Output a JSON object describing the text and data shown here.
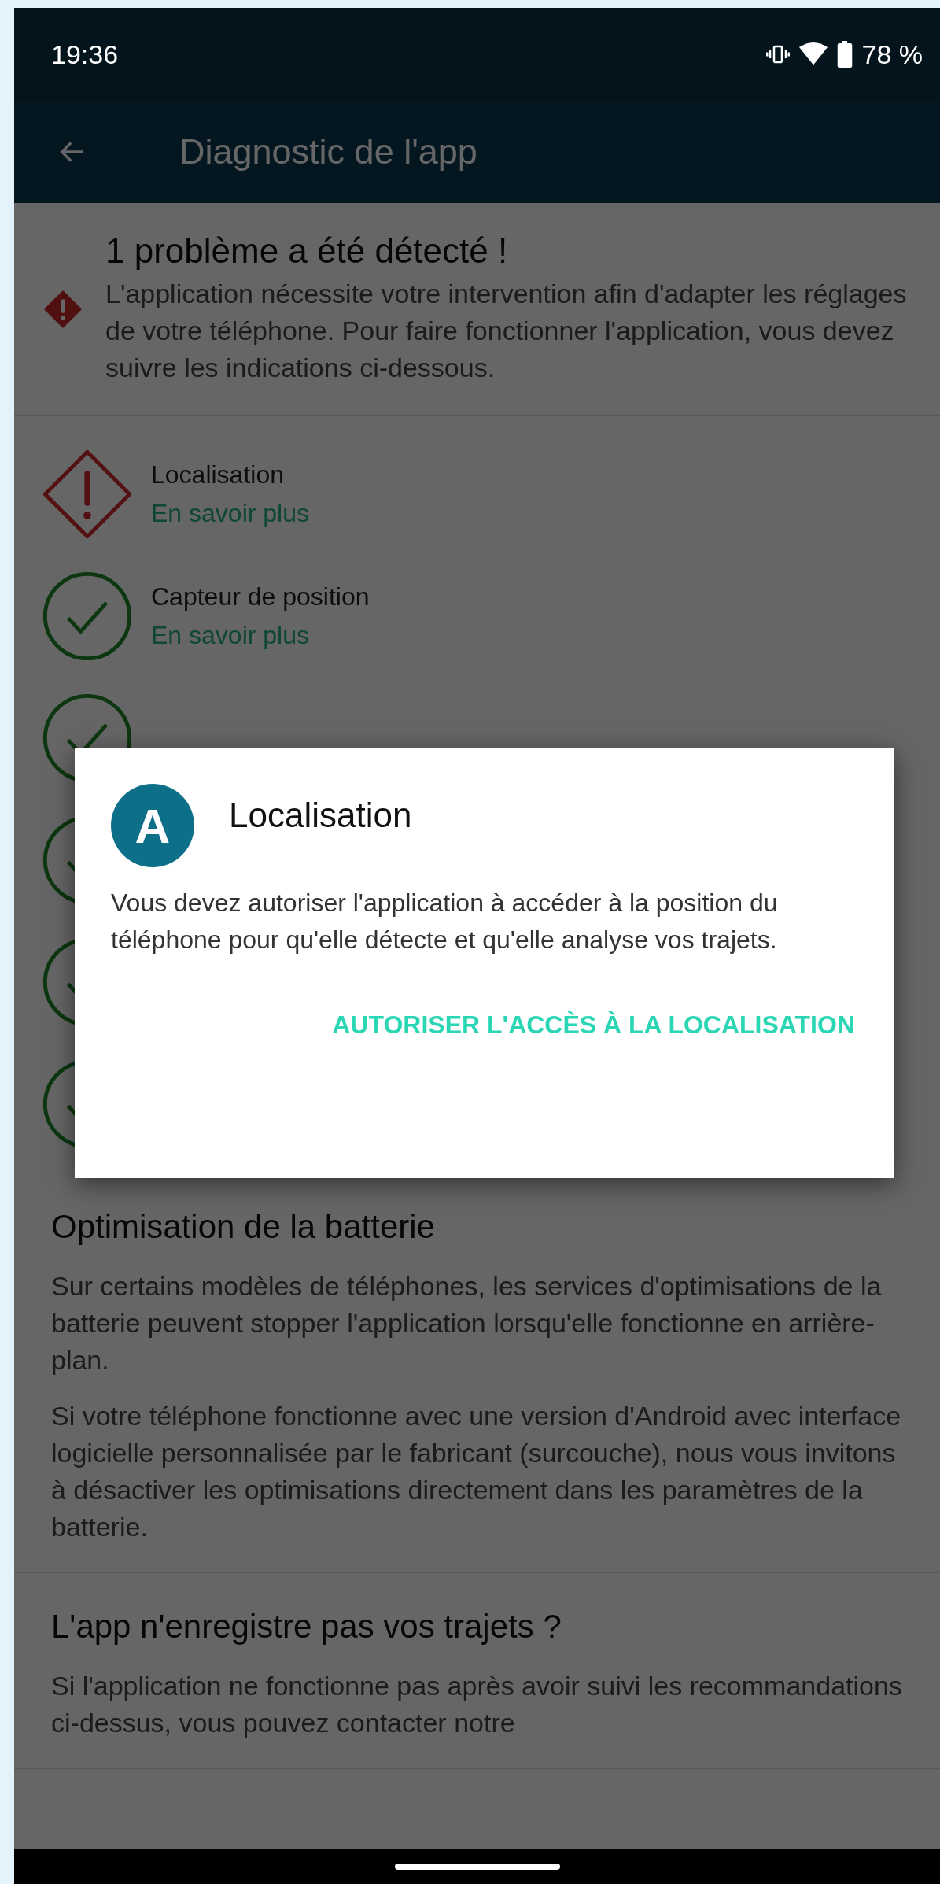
{
  "status_bar": {
    "time": "19:36",
    "battery": "78 %"
  },
  "app_bar": {
    "title": "Diagnostic de l'app"
  },
  "alert": {
    "title": "1 problème a été détecté !",
    "message": "L'application nécessite votre intervention afin d'adapter les réglages de votre téléphone. Pour faire fonctionner l'application, vous devez suivre les indications ci-dessous."
  },
  "checks": [
    {
      "kind": "warning",
      "title": "Localisation",
      "link": "En savoir plus"
    },
    {
      "kind": "ok",
      "title": "Capteur de position",
      "link": "En savoir plus"
    },
    {
      "kind": "ok"
    },
    {
      "kind": "ok"
    },
    {
      "kind": "ok"
    },
    {
      "kind": "ok"
    }
  ],
  "sections": [
    {
      "title": "Optimisation de la batterie",
      "paragraphs": [
        "Sur certains modèles de téléphones, les services d'optimisations de la batterie peuvent stopper l'application lorsqu'elle fonctionne en arrière-plan.",
        "Si votre téléphone fonctionne avec une version d'Android avec interface logicielle personnalisée par le fabricant (surcouche), nous vous invitons à désactiver les optimisations directement dans les paramètres de la batterie."
      ]
    },
    {
      "title": "L'app n'enregistre pas vos trajets ?",
      "paragraphs": [
        "Si l'application ne fonctionne pas après avoir suivi les recommandations ci-dessus, vous pouvez contacter notre"
      ]
    }
  ],
  "dialog": {
    "avatar_letter": "A",
    "title": "Localisation",
    "message": "Vous devez autoriser l'application à accéder à la position du téléphone pour qu'elle détecte et qu'elle analyse vos trajets.",
    "action": "AUTORISER L'ACCÈS À LA LOCALISATION"
  }
}
